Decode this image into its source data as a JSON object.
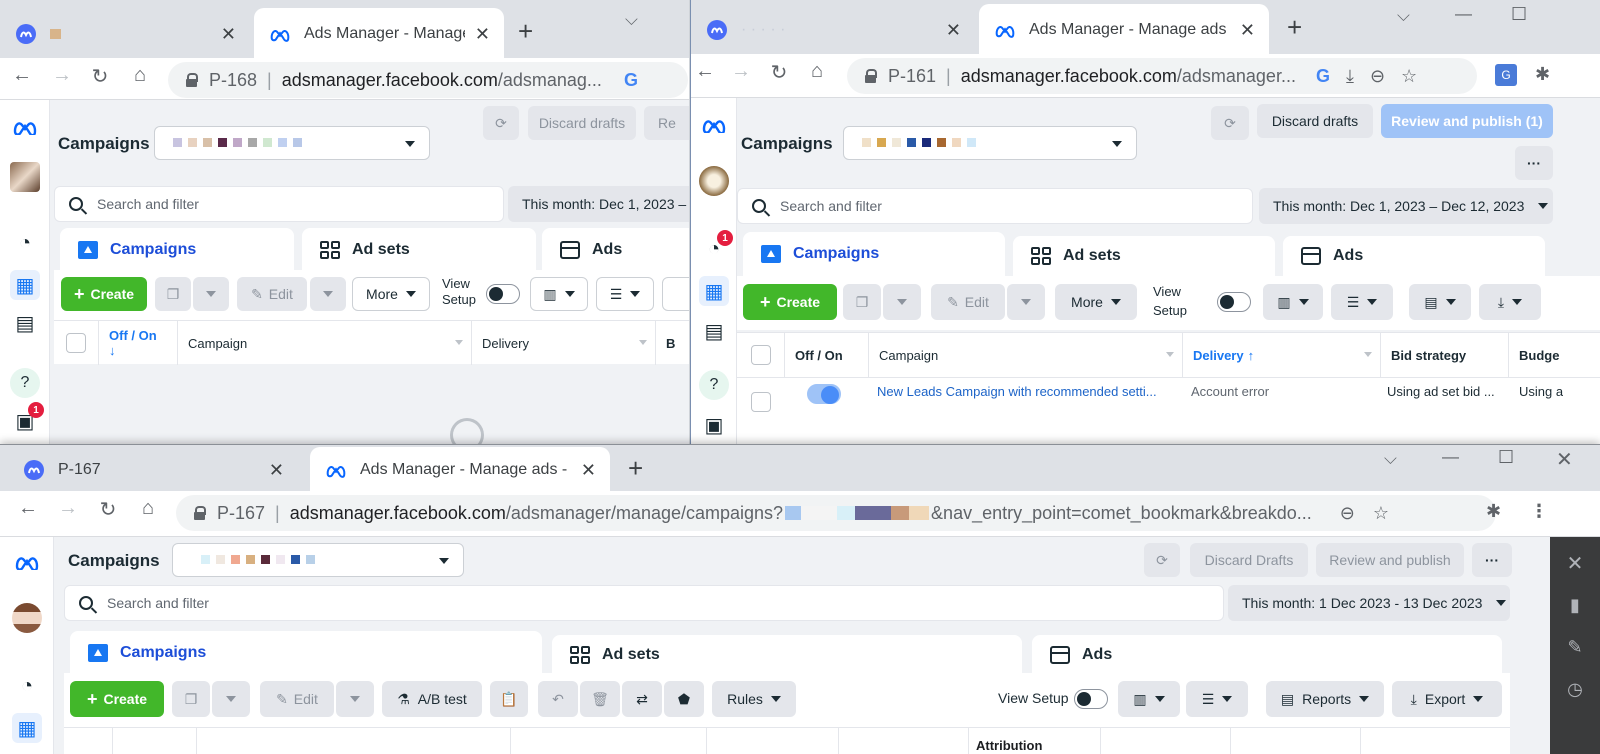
{
  "windows": {
    "w1": {
      "tab_inactive_title": "",
      "tab_active_title": "Ads Manager - Manage",
      "address_id": "P-168",
      "url_domain": "adsmanager.facebook.com",
      "url_path": "/adsmanag...",
      "header_title": "Campaigns",
      "discard_label": "Discard drafts",
      "review_label": "Re",
      "search_placeholder": "Search and filter",
      "date_range": "This month: Dec 1, 2023 –",
      "tabs": [
        "Campaigns",
        "Ad sets",
        "Ads"
      ],
      "create_label": "Create",
      "edit_label": "Edit",
      "more_label": "More",
      "view_setup_label": "View Setup",
      "columns": [
        "Off / On",
        "Campaign",
        "Delivery",
        "B"
      ],
      "sort_arrow": "↓",
      "badge_count": "1"
    },
    "w2": {
      "tab_active_title": "Ads Manager - Manage ads - C",
      "address_id": "P-161",
      "url_domain": "adsmanager.facebook.com",
      "url_path": "/adsmanager...",
      "header_title": "Campaigns",
      "discard_label": "Discard drafts",
      "review_label": "Review and publish (1)",
      "search_placeholder": "Search and filter",
      "date_range": "This month: Dec 1, 2023 – Dec 12, 2023",
      "tabs": [
        "Campaigns",
        "Ad sets",
        "Ads"
      ],
      "create_label": "Create",
      "edit_label": "Edit",
      "more_label": "More",
      "view_setup_label": "View Setup",
      "columns": [
        "Off / On",
        "Campaign",
        "Delivery",
        "Bid strategy",
        "Budge"
      ],
      "sort_arrow": "↑",
      "row": {
        "campaign": "New Leads Campaign with recommended setti...",
        "delivery": "Account error",
        "bid_strategy": "Using ad set bid ...",
        "budget": "Using a"
      },
      "badge_count": "1"
    },
    "w3": {
      "tab_inactive_title": "P-167",
      "tab_active_title": "Ads Manager - Manage ads - C",
      "address_id": "P-167",
      "url_domain": "adsmanager.facebook.com",
      "url_path": "/adsmanager/manage/campaigns?",
      "url_tail": "&nav_entry_point=comet_bookmark&breakdo...",
      "header_title": "Campaigns",
      "discard_label": "Discard Drafts",
      "review_label": "Review and publish",
      "search_placeholder": "Search and filter",
      "date_range": "This month: 1 Dec 2023 - 13 Dec 2023",
      "tabs": [
        "Campaigns",
        "Ad sets",
        "Ads"
      ],
      "create_label": "Create",
      "edit_label": "Edit",
      "ab_test_label": "A/B test",
      "rules_label": "Rules",
      "view_setup_label": "View Setup",
      "reports_label": "Reports",
      "export_label": "Export",
      "attribution_label": "Attribution"
    }
  },
  "colors": {
    "accent_blue": "#1877f2",
    "create_green": "#42b72a",
    "publish_disabled_blue": "#9fc3f7",
    "badge_red": "#e41e3f"
  }
}
